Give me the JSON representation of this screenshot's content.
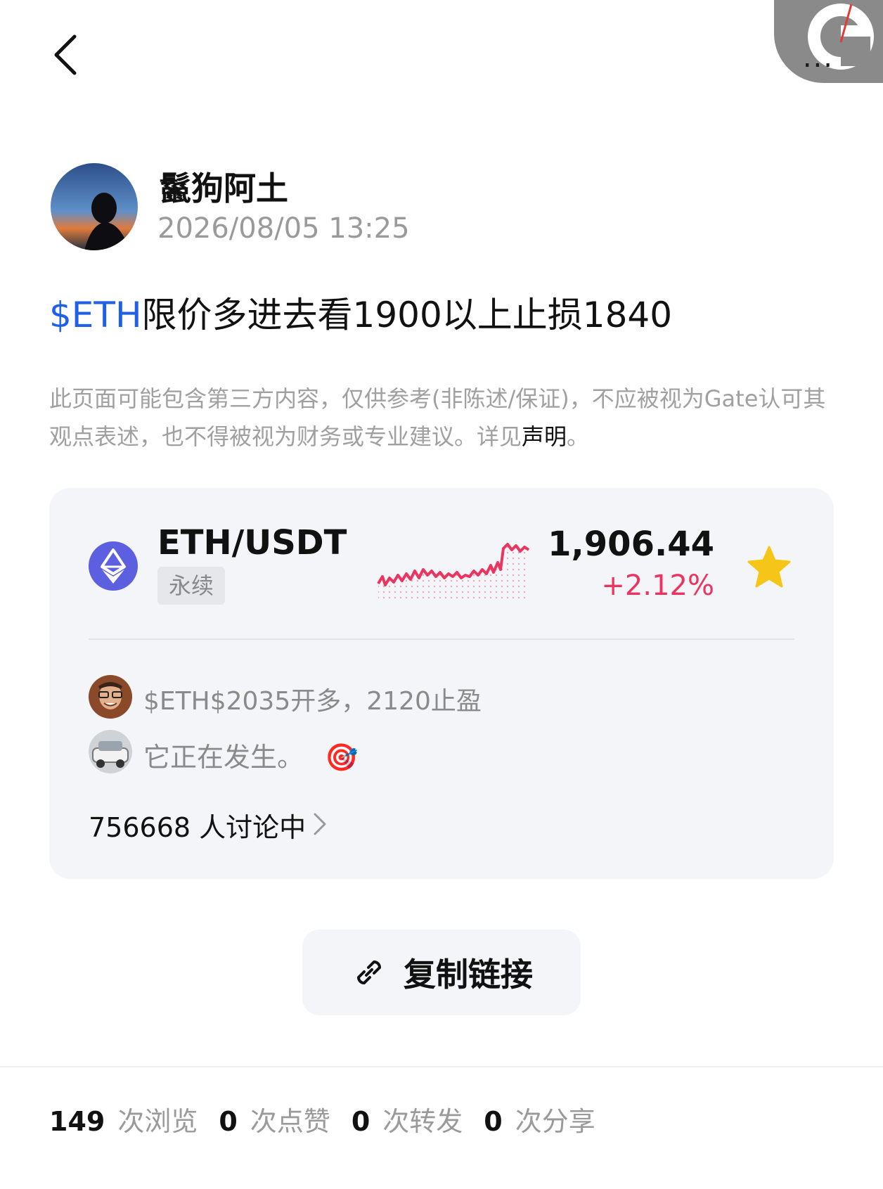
{
  "header": {
    "more_label": "...",
    "back_icon": "chevron-left-icon",
    "brand_icon": "gate-logo-icon"
  },
  "author": {
    "name": "鬣狗阿土",
    "time": "2026/08/05 13:25"
  },
  "post": {
    "ticker": "$ETH",
    "text": "限价多进去看1900以上止损1840"
  },
  "disclaimer": {
    "text": "此页面可能包含第三方内容，仅供参考(非陈述/保证)，不应被视为Gate认可其观点表述，也不得被视为财务或专业建议。详见",
    "link": "声明",
    "end": "。"
  },
  "market_card": {
    "pair": "ETH/USDT",
    "tag": "永续",
    "price": "1,906.44",
    "change": "+2.12%",
    "colors": {
      "up": "#e9355f",
      "star": "#f5c518",
      "eth": "#5b5fe0"
    },
    "comments": [
      {
        "text": "$ETH$2035开多，2120止盈",
        "emoji": ""
      },
      {
        "text": "它正在发生。",
        "emoji": "🎯"
      }
    ],
    "discussion": "756668 人讨论中"
  },
  "copy_link": {
    "label": "复制链接",
    "icon": "link-icon"
  },
  "stats": [
    {
      "num": "149",
      "label": "次浏览"
    },
    {
      "num": "0",
      "label": "次点赞"
    },
    {
      "num": "0",
      "label": "次转发"
    },
    {
      "num": "0",
      "label": "次分享"
    }
  ]
}
